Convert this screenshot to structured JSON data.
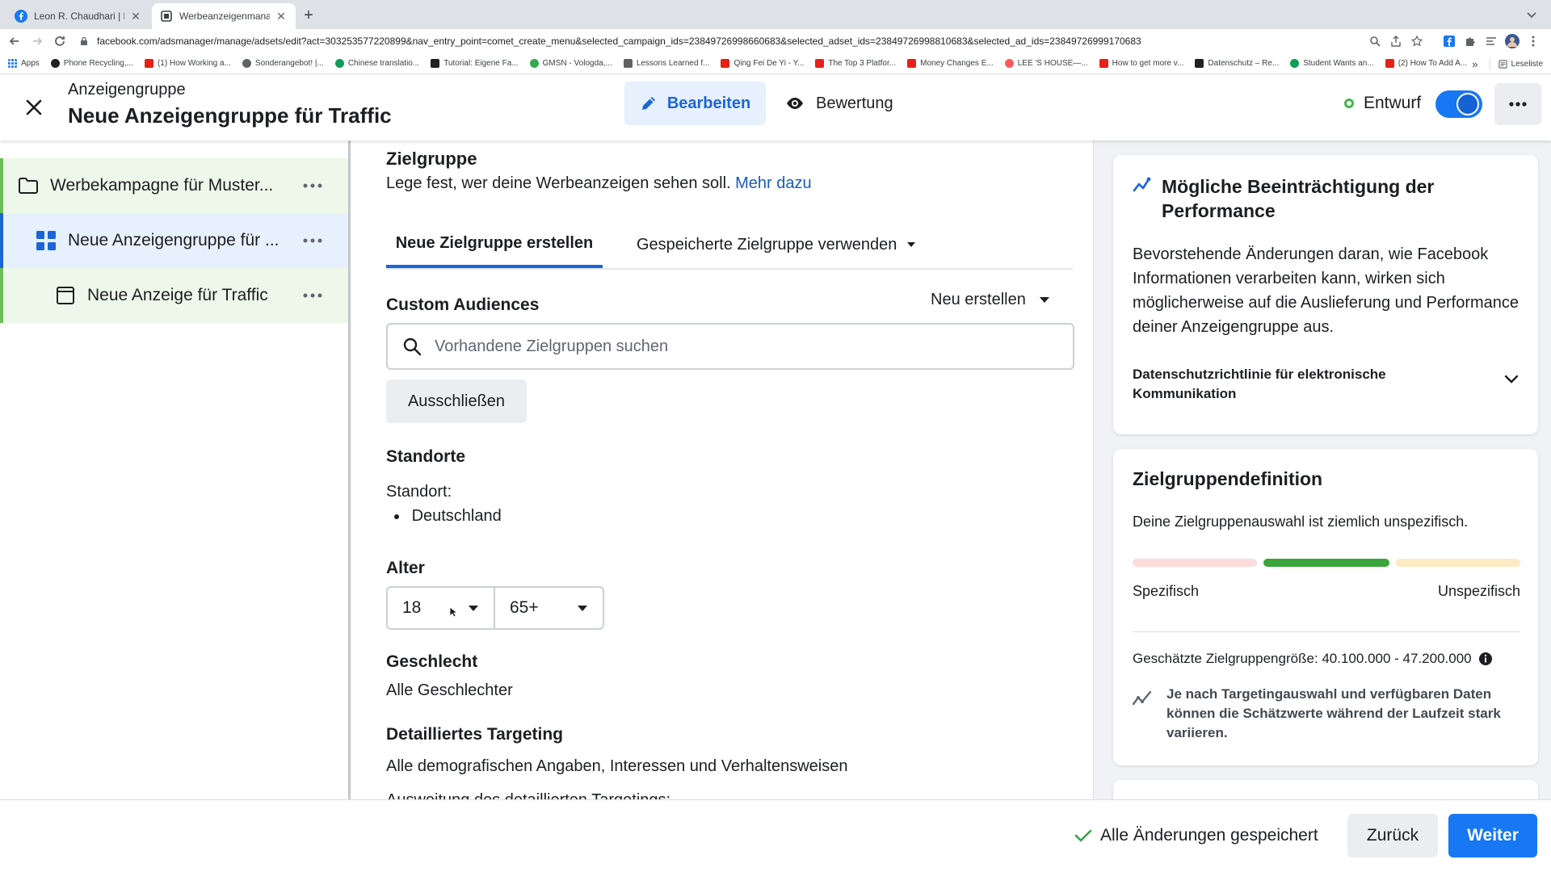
{
  "browser": {
    "tabs": [
      {
        "title": "Leon R. Chaudhari | Facebook",
        "close": "✕"
      },
      {
        "title": "Werbeanzeigenmanager - Wer",
        "close": "✕"
      }
    ],
    "new_tab": "+",
    "url": "facebook.com/adsmanager/manage/adsets/edit?act=303253577220899&nav_entry_point=comet_create_menu&selected_campaign_ids=23849726998660683&selected_adset_ids=23849726998810683&selected_ad_ids=23849726999170683",
    "bookmarks": [
      {
        "label": "Apps",
        "color": "#5f6368"
      },
      {
        "label": "Phone Recycling,...",
        "color": "#202124"
      },
      {
        "label": "(1) How Working a...",
        "color": "#e62117"
      },
      {
        "label": "Sonderangebot! |...",
        "color": "#5f6368"
      },
      {
        "label": "Chinese translatio...",
        "color": "#0f9d58"
      },
      {
        "label": "Tutorial: Eigene Fa...",
        "color": "#202124"
      },
      {
        "label": "GMSN - Vologda,...",
        "color": "#34a853"
      },
      {
        "label": "Lessons Learned f...",
        "color": "#5f6368"
      },
      {
        "label": "Qing Fei De Yi - Y...",
        "color": "#e62117"
      },
      {
        "label": "The Top 3 Platfor...",
        "color": "#e62117"
      },
      {
        "label": "Money Changes E...",
        "color": "#e62117"
      },
      {
        "label": "LEE 'S HOUSE—...",
        "color": "#ff5a5f"
      },
      {
        "label": "How to get more v...",
        "color": "#e62117"
      },
      {
        "label": "Datenschutz – Re...",
        "color": "#202124"
      },
      {
        "label": "Student Wants an...",
        "color": "#0f9d58"
      },
      {
        "label": "(2) How To Add A...",
        "color": "#e62117"
      }
    ],
    "bookmarks_overflow": "»",
    "reading_list": "Leseliste"
  },
  "header": {
    "subtitle": "Anzeigengruppe",
    "title": "Neue Anzeigengruppe für Traffic",
    "tab_edit": "Bearbeiten",
    "tab_review": "Bewertung",
    "status": "Entwurf",
    "colors": {
      "accent": "#1877f2",
      "status_green": "#44b74a"
    }
  },
  "tree": [
    {
      "label": "Werbekampagne für Muster...",
      "icon": "folder-icon",
      "active": false
    },
    {
      "label": "Neue Anzeigengruppe für ...",
      "icon": "adset-grid-icon",
      "active": true
    },
    {
      "label": "Neue Anzeige für Traffic",
      "icon": "ad-icon",
      "active": false
    }
  ],
  "main": {
    "zielgruppe": {
      "title": "Zielgruppe",
      "description": "Lege fest, wer deine Werbeanzeigen sehen soll.",
      "link": "Mehr dazu"
    },
    "tabs": [
      "Neue Zielgruppe erstellen",
      "Gespeicherte Zielgruppe verwenden"
    ],
    "custom_audiences": {
      "title": "Custom Audiences",
      "create_new": "Neu erstellen",
      "search_placeholder": "Vorhandene Zielgruppen suchen",
      "exclude": "Ausschließen"
    },
    "locations": {
      "title": "Standorte",
      "label": "Standort:",
      "items": [
        "Deutschland"
      ]
    },
    "age": {
      "title": "Alter",
      "min": "18",
      "max": "65+"
    },
    "gender": {
      "title": "Geschlecht",
      "value": "Alle Geschlechter"
    },
    "detailed_targeting": {
      "title": "Detailliertes Targeting",
      "value": "Alle demografischen Angaben, Interessen und Verhaltensweisen",
      "expansion": "Ausweitung des detaillierten Targetings:"
    }
  },
  "right": {
    "performance": {
      "title": "Mögliche Beeinträchtigung der Performance",
      "body": "Bevorstehende Änderungen daran, wie Facebook Informationen verarbeiten kann, wirken sich möglicherweise auf die Auslieferung und Performance deiner Anzeigengruppe aus.",
      "policy": "Datenschutzrichtlinie für elektronische Kommunikation"
    },
    "audience_definition": {
      "title": "Zielgruppendefinition",
      "description": "Deine Zielgruppenauswahl ist ziemlich unspezifisch.",
      "label_left": "Spezifisch",
      "label_right": "Unspezifisch",
      "meter_colors": [
        "#fcdcdc",
        "#3ba43b",
        "#fcebc3"
      ],
      "size": "Geschätzte Zielgruppengröße: 40.100.000 - 47.200.000",
      "note": "Je nach Targetingauswahl und verfügbaren Daten können die Schätzwerte während der Laufzeit stark variieren."
    }
  },
  "footer": {
    "saved": "Alle Änderungen gespeichert",
    "back": "Zurück",
    "next": "Weiter"
  }
}
